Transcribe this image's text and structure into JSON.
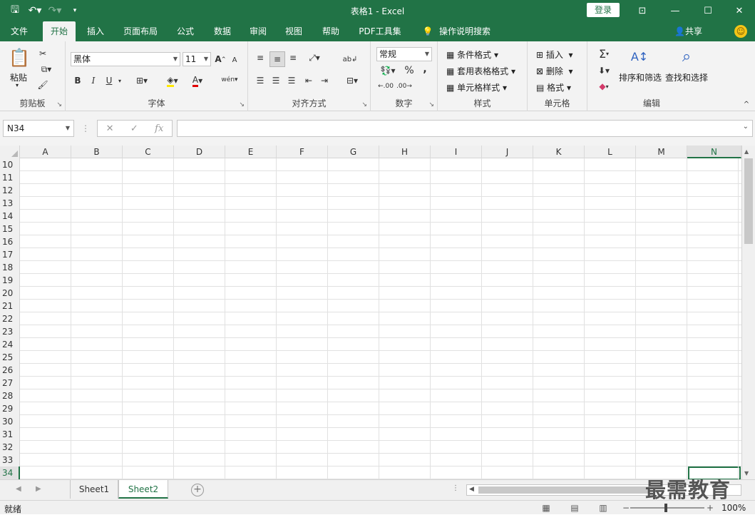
{
  "window": {
    "title": "表格1 - Excel",
    "login_label": "登录"
  },
  "tabs": [
    "文件",
    "开始",
    "插入",
    "页面布局",
    "公式",
    "数据",
    "审阅",
    "视图",
    "帮助",
    "PDF工具集",
    "操作说明搜索"
  ],
  "share_label": "共享",
  "ribbon": {
    "clipboard": {
      "label": "剪贴板",
      "paste": "粘贴"
    },
    "font": {
      "label": "字体",
      "name": "黑体",
      "size": "11",
      "bold": "B",
      "italic": "I",
      "underline": "U",
      "grow": "A",
      "shrink": "A",
      "fontcolor": "A",
      "wen": "wén"
    },
    "alignment": {
      "label": "对齐方式"
    },
    "number": {
      "label": "数字",
      "format": "常规",
      "percent": "%",
      "comma": ",",
      "dec_inc": ".00",
      "dec_dec": ".00"
    },
    "styles": {
      "label": "样式",
      "cond": "条件格式",
      "table": "套用表格格式",
      "cell": "单元格样式"
    },
    "cells": {
      "label": "单元格",
      "insert": "插入",
      "delete": "删除",
      "format": "格式"
    },
    "editing": {
      "label": "编辑",
      "sort": "排序和筛选",
      "find": "查找和选择"
    }
  },
  "formula_bar": {
    "name_box": "N34",
    "fx": "fx"
  },
  "grid": {
    "columns": [
      "A",
      "B",
      "C",
      "D",
      "E",
      "F",
      "G",
      "H",
      "I",
      "J",
      "K",
      "L",
      "M",
      "N"
    ],
    "rows": [
      "10",
      "11",
      "12",
      "13",
      "14",
      "15",
      "16",
      "17",
      "18",
      "19",
      "20",
      "21",
      "22",
      "23",
      "24",
      "25",
      "26",
      "27",
      "28",
      "29",
      "30",
      "31",
      "32",
      "33",
      "34"
    ],
    "selected_column": "N",
    "selected_row": "34"
  },
  "sheets": [
    "Sheet1",
    "Sheet2"
  ],
  "active_sheet": "Sheet2",
  "status": {
    "ready": "就绪",
    "zoom": "100%"
  },
  "watermark": "最需教育",
  "colors": {
    "accent": "#217346",
    "ribbon_bg": "#f3f3f3"
  }
}
